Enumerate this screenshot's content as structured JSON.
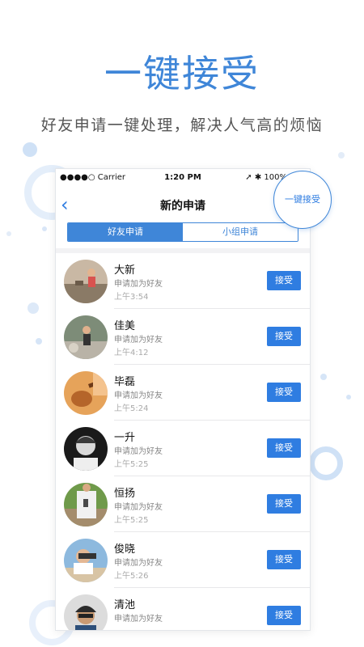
{
  "headline": "一键接受",
  "subheadline": "好友申请一键处理，解决人气高的烦恼",
  "status_bar": {
    "carrier": "●●●●○ Carrier ",
    "time": "1:20 PM",
    "battery": "➚ ✱ 100%"
  },
  "nav": {
    "back_icon": "‹",
    "title": "新的申请",
    "right_action_partial": "一键"
  },
  "callout": {
    "label": "一键接受"
  },
  "tabs": [
    {
      "label": "好友申请",
      "active": true
    },
    {
      "label": "小组申请",
      "active": false
    }
  ],
  "requests": [
    {
      "name": "大新",
      "message": "申请加为好友",
      "time": "上午3:54",
      "button": "接受"
    },
    {
      "name": "佳美",
      "message": "申请加为好友",
      "time": "上午4:12",
      "button": "接受"
    },
    {
      "name": "毕磊",
      "message": "申请加为好友",
      "time": "上午5:24",
      "button": "接受"
    },
    {
      "name": "一升",
      "message": "申请加为好友",
      "time": "上午5:25",
      "button": "接受"
    },
    {
      "name": "恒扬",
      "message": "申请加为好友",
      "time": "上午5:25",
      "button": "接受"
    },
    {
      "name": "俊晓",
      "message": "申请加为好友",
      "time": "上午5:26",
      "button": "接受"
    },
    {
      "name": "清池",
      "message": "申请加为好友",
      "time": "",
      "button": "接受"
    }
  ],
  "colors": {
    "accent": "#3f86d8",
    "button": "#2f7de1"
  }
}
